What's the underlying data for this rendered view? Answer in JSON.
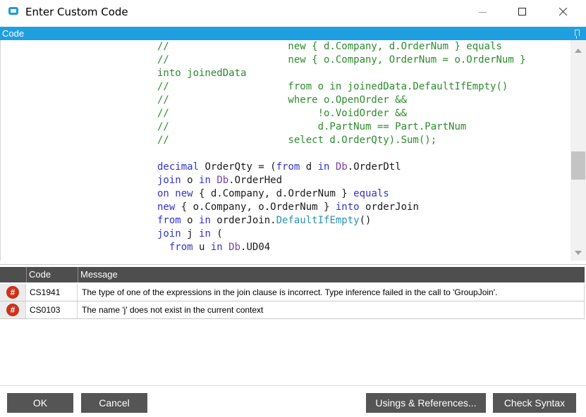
{
  "window": {
    "title": "Enter Custom Code"
  },
  "code_panel": {
    "header": "Code"
  },
  "code_lines": [
    [
      {
        "t": "//",
        "c": "comment"
      },
      {
        "t": "                    new { d.Company, d.OrderNum } equals",
        "c": "comment"
      }
    ],
    [
      {
        "t": "//",
        "c": "comment"
      },
      {
        "t": "                    new { o.Company, OrderNum = o.OrderNum }",
        "c": "comment"
      }
    ],
    [
      {
        "t": "into joinedData",
        "c": "comment"
      }
    ],
    [
      {
        "t": "//",
        "c": "comment"
      },
      {
        "t": "                    from o in joinedData.DefaultIfEmpty()",
        "c": "comment"
      }
    ],
    [
      {
        "t": "//",
        "c": "comment"
      },
      {
        "t": "                    where o.OpenOrder &&",
        "c": "comment"
      }
    ],
    [
      {
        "t": "//",
        "c": "comment"
      },
      {
        "t": "                         !o.VoidOrder &&",
        "c": "comment"
      }
    ],
    [
      {
        "t": "//",
        "c": "comment"
      },
      {
        "t": "                         d.PartNum == Part.PartNum",
        "c": "comment"
      }
    ],
    [
      {
        "t": "//",
        "c": "comment"
      },
      {
        "t": "                    select d.OrderQty).Sum();",
        "c": "comment"
      }
    ],
    [],
    [
      {
        "t": "decimal",
        "c": "kw"
      },
      {
        "t": " OrderQty = (",
        "c": "plain"
      },
      {
        "t": "from",
        "c": "kw"
      },
      {
        "t": " d ",
        "c": "plain"
      },
      {
        "t": "in",
        "c": "kw"
      },
      {
        "t": " ",
        "c": "plain"
      },
      {
        "t": "Db",
        "c": "var"
      },
      {
        "t": ".OrderDtl",
        "c": "plain"
      }
    ],
    [
      {
        "t": "join",
        "c": "kw"
      },
      {
        "t": " o ",
        "c": "plain"
      },
      {
        "t": "in",
        "c": "kw"
      },
      {
        "t": " ",
        "c": "plain"
      },
      {
        "t": "Db",
        "c": "var"
      },
      {
        "t": ".OrderHed",
        "c": "plain"
      }
    ],
    [
      {
        "t": "on",
        "c": "kw"
      },
      {
        "t": " ",
        "c": "plain"
      },
      {
        "t": "new",
        "c": "kw"
      },
      {
        "t": " { d.Company, d.OrderNum } ",
        "c": "plain"
      },
      {
        "t": "equals",
        "c": "kw"
      }
    ],
    [
      {
        "t": "new",
        "c": "kw"
      },
      {
        "t": " { o.Company, o.OrderNum } ",
        "c": "plain"
      },
      {
        "t": "into",
        "c": "kw"
      },
      {
        "t": " orderJoin",
        "c": "plain"
      }
    ],
    [
      {
        "t": "from",
        "c": "kw"
      },
      {
        "t": " o ",
        "c": "plain"
      },
      {
        "t": "in",
        "c": "kw"
      },
      {
        "t": " orderJoin.",
        "c": "plain"
      },
      {
        "t": "DefaultIfEmpty",
        "c": "type"
      },
      {
        "t": "()",
        "c": "plain"
      }
    ],
    [
      {
        "t": "join",
        "c": "kw"
      },
      {
        "t": " j ",
        "c": "plain"
      },
      {
        "t": "in",
        "c": "kw"
      },
      {
        "t": " (",
        "c": "plain"
      }
    ],
    [
      {
        "t": "  from",
        "c": "kw"
      },
      {
        "t": " u ",
        "c": "plain"
      },
      {
        "t": "in",
        "c": "kw"
      },
      {
        "t": " ",
        "c": "plain"
      },
      {
        "t": "Db",
        "c": "var"
      },
      {
        "t": ".UD04",
        "c": "plain"
      }
    ]
  ],
  "errors_grid": {
    "columns": [
      "Code",
      "Message"
    ],
    "rows": [
      {
        "icon": "#",
        "code": "CS1941",
        "message": "The type of one of the expressions in the join clause is incorrect.  Type inference failed in the call to 'GroupJoin'."
      },
      {
        "icon": "#",
        "code": "CS0103",
        "message": "The name 'j' does not exist in the current context"
      }
    ]
  },
  "buttons": {
    "ok": "OK",
    "cancel": "Cancel",
    "usings": "Usings & References...",
    "check_syntax": "Check Syntax"
  },
  "colors": {
    "accent": "#1e9fe0",
    "error": "#c9331e",
    "button": "#555555"
  }
}
